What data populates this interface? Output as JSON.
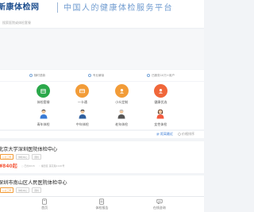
{
  "header": {
    "logo_text": "新康体检网",
    "slogan": "中国人的健康体检服务平台"
  },
  "search": {
    "placeholder": "搜索医院或体检套餐"
  },
  "features": [
    {
      "label": "随时退款"
    },
    {
      "label": "专业解读"
    },
    {
      "label": "已服务10万+用户"
    }
  ],
  "categories": [
    {
      "label": "体检套餐",
      "icon": "package-icon",
      "color": "#2aa84a"
    },
    {
      "label": "一卡通",
      "icon": "card-icon",
      "color": "#f29c38"
    },
    {
      "label": "小众定制",
      "icon": "custom-icon",
      "color": "#f29c38"
    },
    {
      "label": "健康优选",
      "icon": "selection-icon",
      "color": "#f0673a"
    },
    {
      "label": "青年体检",
      "icon": "young-person-icon",
      "color": "#3a7bd5"
    },
    {
      "label": "中年体检",
      "icon": "middle-aged-person-icon",
      "color": "#3a7bd5"
    },
    {
      "label": "老年体检",
      "icon": "elderly-person-icon",
      "color": "#3a7bd5"
    },
    {
      "label": "女性体检",
      "icon": "female-person-icon",
      "color": "#f45a3d"
    }
  ],
  "sort": {
    "distance_label": "距离最近",
    "price_label": "价格排序"
  },
  "hospitals": [
    {
      "name": "北京大学深圳医院体检中心",
      "tags": [
        "公立三甲",
        "体检中心",
        "团检"
      ],
      "price": "¥840起",
      "meta_1": "已约2015",
      "meta_2": "福田区 莲花路1120号"
    },
    {
      "name": "深圳市南山区人民医院体检中心",
      "tags": [
        "公立三甲",
        "体检中心",
        "团检"
      ]
    }
  ],
  "tabs": [
    {
      "label": "首页",
      "icon": "home-icon"
    },
    {
      "label": "体检报告",
      "icon": "report-icon"
    },
    {
      "label": "在线咨询",
      "icon": "chat-icon"
    }
  ]
}
